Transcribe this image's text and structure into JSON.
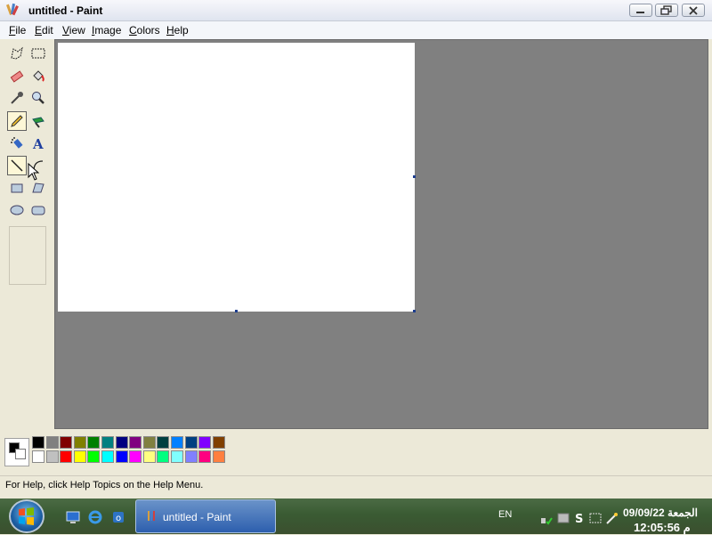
{
  "window": {
    "title": "untitled - Paint"
  },
  "menu": [
    {
      "label": "File",
      "accel": "F",
      "rest": "ile"
    },
    {
      "label": "Edit",
      "accel": "E",
      "rest": "dit"
    },
    {
      "label": "View",
      "accel": "V",
      "rest": "iew"
    },
    {
      "label": "Image",
      "accel": "I",
      "rest": "mage"
    },
    {
      "label": "Colors",
      "accel": "C",
      "rest": "olors"
    },
    {
      "label": "Help",
      "accel": "H",
      "rest": "elp"
    }
  ],
  "tools": [
    {
      "name": "free-form-select-icon"
    },
    {
      "name": "rect-select-icon"
    },
    {
      "name": "eraser-icon"
    },
    {
      "name": "fill-icon"
    },
    {
      "name": "pick-color-icon"
    },
    {
      "name": "magnifier-icon"
    },
    {
      "name": "pencil-icon",
      "active": true
    },
    {
      "name": "brush-icon"
    },
    {
      "name": "airbrush-icon"
    },
    {
      "name": "text-icon"
    },
    {
      "name": "line-icon",
      "active": true
    },
    {
      "name": "curve-icon"
    },
    {
      "name": "rectangle-icon"
    },
    {
      "name": "polygon-icon"
    },
    {
      "name": "ellipse-icon"
    },
    {
      "name": "rounded-rectangle-icon"
    }
  ],
  "palette": {
    "foreground": "#000000",
    "background": "#ffffff",
    "row1": [
      "#000000",
      "#808080",
      "#800000",
      "#808000",
      "#008000",
      "#008080",
      "#000080",
      "#800080",
      "#808040",
      "#004040",
      "#0080ff",
      "#004080",
      "#8000ff",
      "#804000"
    ],
    "row2": [
      "#ffffff",
      "#c0c0c0",
      "#ff0000",
      "#ffff00",
      "#00ff00",
      "#00ffff",
      "#0000ff",
      "#ff00ff",
      "#ffff80",
      "#00ff80",
      "#80ffff",
      "#8080ff",
      "#ff0080",
      "#ff8040"
    ]
  },
  "status": {
    "text": "For Help, click Help Topics on the Help Menu."
  },
  "taskbar": {
    "task_label": "untitled - Paint",
    "language": "EN",
    "date": "الجمعة 09/09/22",
    "time": "12:05:56 م"
  }
}
